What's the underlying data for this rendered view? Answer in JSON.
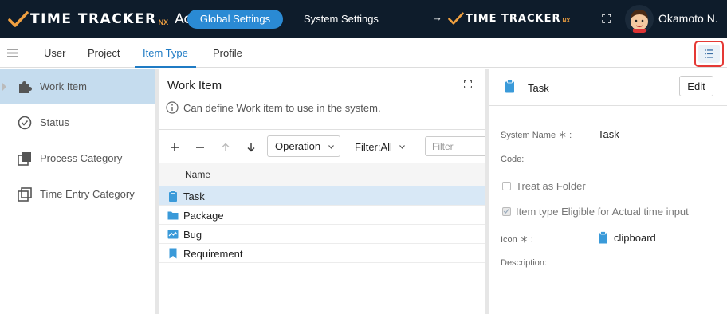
{
  "header": {
    "brand": "TIME TRACKER",
    "brand_suffix": "NX",
    "admin_label": "Admin",
    "tabs": [
      {
        "label": "Global Settings",
        "active": true
      },
      {
        "label": "System Settings",
        "active": false
      }
    ],
    "app_link_arrow": "→",
    "app_link_brand": "TIME TRACKER",
    "app_link_suffix": "NX",
    "user_name": "Okamoto N."
  },
  "nav": {
    "items": [
      {
        "label": "User",
        "active": false
      },
      {
        "label": "Project",
        "active": false
      },
      {
        "label": "Item Type",
        "active": true
      },
      {
        "label": "Profile",
        "active": false
      }
    ]
  },
  "sidebar": {
    "items": [
      {
        "label": "Work Item",
        "icon": "puzzle-icon",
        "active": true
      },
      {
        "label": "Status",
        "icon": "check-circle-icon",
        "active": false
      },
      {
        "label": "Process Category",
        "icon": "layers-icon",
        "active": false
      },
      {
        "label": "Time Entry Category",
        "icon": "square-stack-icon",
        "active": false
      }
    ]
  },
  "middle": {
    "title": "Work Item",
    "info": "Can define Work item to use in the system.",
    "operation_label": "Operation",
    "filter_label": "Filter:All",
    "filter_placeholder": "Filter",
    "column_name": "Name",
    "rows": [
      {
        "label": "Task",
        "icon": "clipboard-icon",
        "selected": true
      },
      {
        "label": "Package",
        "icon": "folder-icon",
        "selected": false
      },
      {
        "label": "Bug",
        "icon": "bug-chart-icon",
        "selected": false
      },
      {
        "label": "Requirement",
        "icon": "bookmark-icon",
        "selected": false
      }
    ]
  },
  "detail": {
    "title": "Task",
    "edit_label": "Edit",
    "system_name_label": "System Name ＊ :",
    "system_name_value": "Task",
    "code_label": "Code:",
    "treat_as_folder_label": "Treat as Folder",
    "treat_as_folder_checked": false,
    "actual_time_label": "Item type Eligible for Actual time input",
    "actual_time_checked": true,
    "icon_label": "Icon ＊ :",
    "icon_value": "clipboard",
    "description_label": "Description:"
  },
  "colors": {
    "header_bg": "#0e1c2b",
    "accent": "#2a8ad4",
    "active_tab": "#1f7bc4",
    "selection": "#d8e8f6",
    "sidebar_active": "#c5dcee",
    "icon_blue": "#3a9ad9",
    "highlight_border": "#e53935"
  }
}
